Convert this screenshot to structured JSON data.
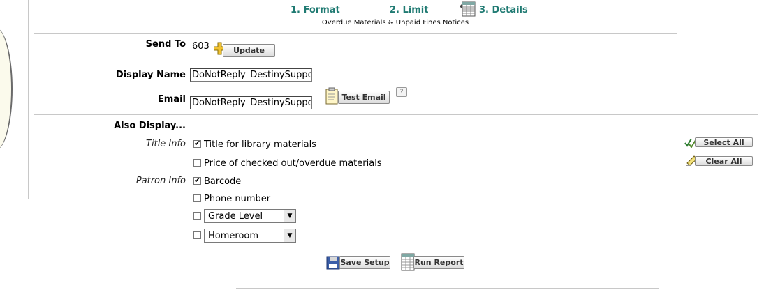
{
  "steps": {
    "format": "1. Format",
    "limit": "2. Limit",
    "details": "3. Details",
    "subtitle": "Overdue Materials & Unpaid Fines Notices"
  },
  "send_to": {
    "label": "Send To",
    "value": "603",
    "update_button": "Update"
  },
  "display_name": {
    "label": "Display Name",
    "value": "DoNotReply_DestinySuppor"
  },
  "email": {
    "label": "Email",
    "value": "DoNotReply_DestinySuppor",
    "test_button": "Test Email",
    "help": "?"
  },
  "also_display": {
    "heading": "Also Display...",
    "title_info_label": "Title Info",
    "patron_info_label": "Patron Info",
    "options": [
      {
        "label": "Title for library materials",
        "checked": true
      },
      {
        "label": "Price of checked out/overdue materials",
        "checked": false
      },
      {
        "label": "Barcode",
        "checked": true
      },
      {
        "label": "Phone number",
        "checked": false
      }
    ],
    "selects": [
      {
        "value": "Grade Level",
        "checked": false
      },
      {
        "value": "Homeroom",
        "checked": false
      }
    ],
    "select_all": "Select All",
    "clear_all": "Clear All"
  },
  "footer": {
    "save_setup": "Save Setup",
    "run_report": "Run Report"
  },
  "icons": [
    "details-table-icon",
    "plus-icon",
    "clipboard-icon",
    "help-icon",
    "checkmarks-icon",
    "eraser-icon",
    "floppy-disk-icon",
    "report-icon"
  ]
}
